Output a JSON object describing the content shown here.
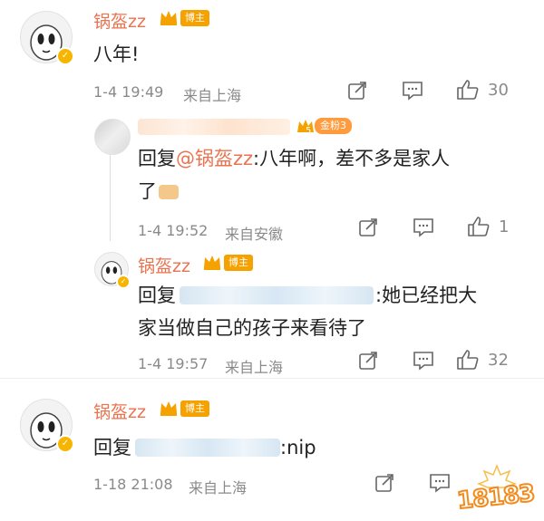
{
  "comments": [
    {
      "username": "锅盔zz",
      "badge": "博主",
      "text": "八年!",
      "time": "1-4 19:49",
      "location": "来自上海",
      "likes": "30"
    },
    {
      "reply_prefix": "回复",
      "mention": "@锅盔zz",
      "text_line1": ":八年啊，差不多是家人",
      "text_line2": "了",
      "fan_badge": "金粉3",
      "fan_level": "5",
      "time": "1-4 19:52",
      "location": "来自安徽",
      "likes": "1"
    },
    {
      "username": "锅盔zz",
      "badge": "博主",
      "reply_prefix": "回复",
      "text_line1": ":她已经把大",
      "text_line2": "家当做自己的孩子来看待了",
      "time": "1-4 19:57",
      "location": "来自上海",
      "likes": "32"
    },
    {
      "username": "锅盔zz",
      "badge": "博主",
      "reply_prefix": "回复",
      "text": ":nip",
      "time": "1-18 21:08",
      "location": "来自上海"
    }
  ],
  "watermark": "18183",
  "icons": [
    "share-icon",
    "comment-icon",
    "like-icon",
    "crown-icon",
    "verified-icon"
  ],
  "colors": {
    "accent": "#eb7350",
    "badge": "#f5a100",
    "meta": "#8a8a8a"
  }
}
